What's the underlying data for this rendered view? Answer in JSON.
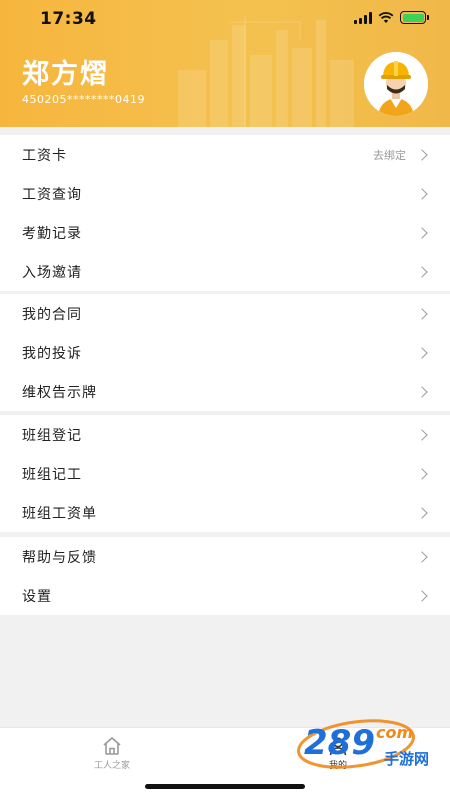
{
  "status_bar": {
    "time": "17:34"
  },
  "profile": {
    "name": "郑方熠",
    "id_number": "450205********0419"
  },
  "menu_groups": [
    {
      "items": [
        {
          "label": "工资卡",
          "hint": "去绑定"
        },
        {
          "label": "工资查询"
        },
        {
          "label": "考勤记录"
        },
        {
          "label": "入场邀请"
        }
      ]
    },
    {
      "items": [
        {
          "label": "我的合同"
        },
        {
          "label": "我的投诉"
        },
        {
          "label": "维权告示牌"
        }
      ]
    },
    {
      "items": [
        {
          "label": "班组登记"
        },
        {
          "label": "班组记工"
        },
        {
          "label": "班组工资单"
        }
      ]
    },
    {
      "items": [
        {
          "label": "帮助与反馈"
        },
        {
          "label": "设置"
        }
      ]
    }
  ],
  "tab_bar": {
    "home_label": "工人之家",
    "mine_label": "我的"
  },
  "watermark": {
    "number": "289",
    "suffix": "com",
    "site": "手游网"
  },
  "colors": {
    "header": "#f4bd4a",
    "accent": "#f6b63e",
    "watermark_blue": "#1e6fd9",
    "watermark_orange": "#f08a1c"
  }
}
